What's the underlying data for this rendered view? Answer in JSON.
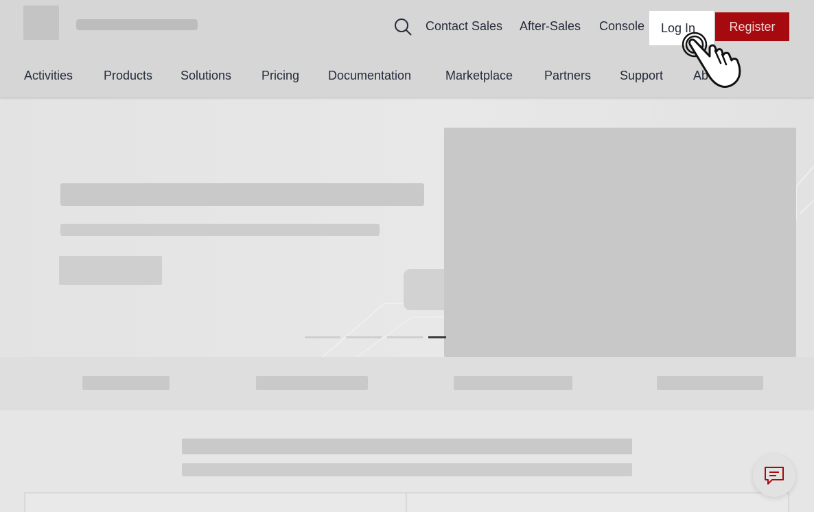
{
  "header": {
    "top_links": {
      "contact_sales": "Contact Sales",
      "after_sales": "After-Sales",
      "console": "Console"
    },
    "login_label": "Log In",
    "register_label": "Register",
    "nav": [
      "Activities",
      "Products",
      "Solutions",
      "Pricing",
      "Documentation",
      "Marketplace",
      "Partners",
      "Support",
      "About"
    ]
  },
  "icons": {
    "search": "search-icon",
    "chat": "chat-icon",
    "cursor": "hand-pointer-icon"
  },
  "colors": {
    "register_bg": "#a60a0f",
    "header_bg": "#d6d6d6",
    "page_bg": "#e6e6e6"
  },
  "hero": {
    "slide_count": 4,
    "active_slide": 4
  }
}
